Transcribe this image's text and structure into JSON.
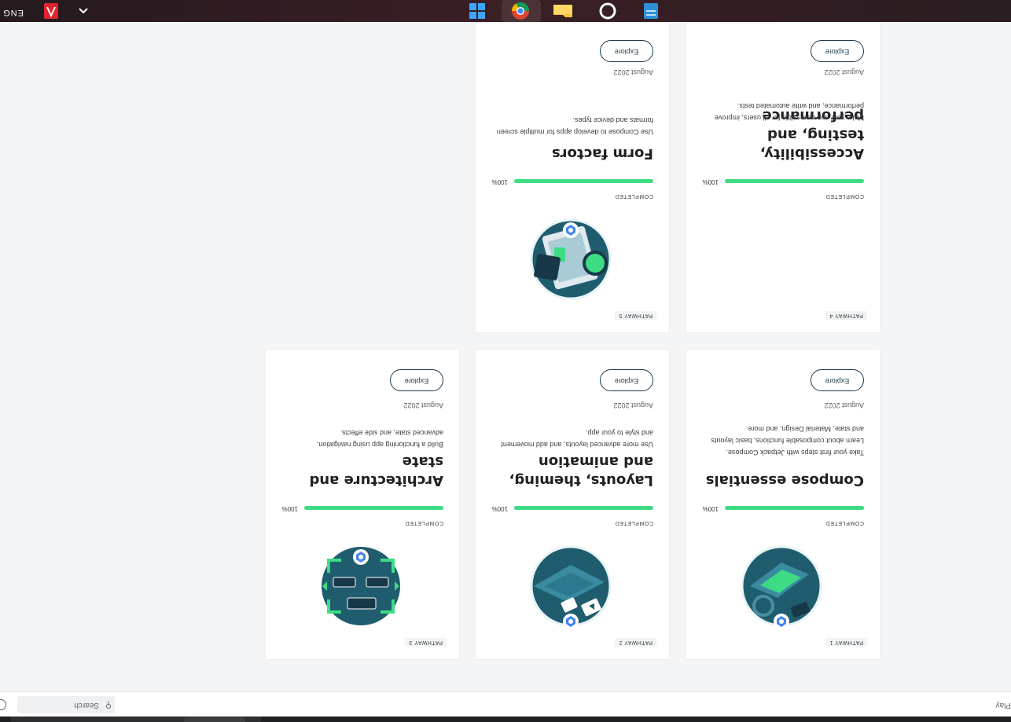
{
  "header": {
    "play_text": "Play",
    "search_placeholder": "Search",
    "search_icon": "search-icon",
    "globe_icon": "globe-icon"
  },
  "colors": {
    "progress": "#3ddc84",
    "title": "#202124",
    "button_border": "#1e3a4c",
    "taskbar": "#2f1d22"
  },
  "pathways": [
    {
      "badge": "PATHWAY 1",
      "status": "COMPLETED",
      "progress_label": "100%",
      "progress": 1.0,
      "title": "Compose essentials",
      "description": "Take your first steps with Jetpack Compose. Learn about composable functions, basic layouts and state, Material Design, and more.",
      "date": "August 2022",
      "button": "Explore",
      "illustration": "compose-essentials-illustration"
    },
    {
      "badge": "PATHWAY 2",
      "status": "COMPLETED",
      "progress_label": "100%",
      "progress": 1.0,
      "title": "Layouts, theming, and animation",
      "description": "Use more advanced layouts, and add movement and style to your app.",
      "date": "August 2022",
      "button": "Explore",
      "illustration": "layouts-theming-illustration"
    },
    {
      "badge": "PATHWAY 3",
      "status": "COMPLETED",
      "progress_label": "100%",
      "progress": 1.0,
      "title": "Architecture and state",
      "description": "Build a functioning app using navigation, advanced state, and side effects.",
      "date": "August 2022",
      "button": "Explore",
      "illustration": "architecture-state-illustration"
    },
    {
      "badge": "PATHWAY 4",
      "status": "COMPLETED",
      "progress_label": "100%",
      "progress": 1.0,
      "title": "Accessibility, testing, and performance",
      "description": "Make your app accessible for all users, improve performance, and write automated tests.",
      "date": "August 2022",
      "button": "Explore",
      "illustration": ""
    },
    {
      "badge": "PATHWAY 5",
      "status": "COMPLETED",
      "progress_label": "100%",
      "progress": 1.0,
      "title": "Form factors",
      "description": "Use Compose to develop apps for multiple screen formats and device types.",
      "date": "August 2022",
      "button": "Explore",
      "illustration": "form-factors-illustration"
    }
  ],
  "taskbar": {
    "language": "ENG",
    "icons": [
      "chevron-up-icon",
      "acrobat-icon",
      "windows-start-icon",
      "cortana-icon",
      "file-explorer-icon",
      "chrome-icon",
      "notepad-icon"
    ]
  }
}
